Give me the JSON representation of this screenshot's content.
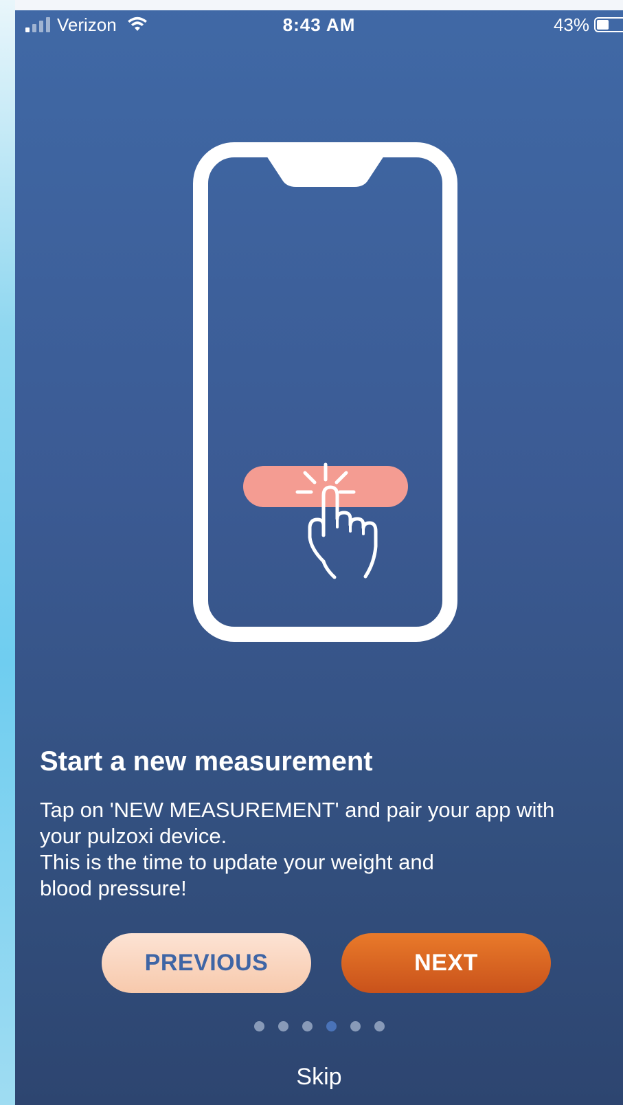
{
  "status_bar": {
    "carrier": "Verizon",
    "time": "8:43 AM",
    "battery_percent": "43%",
    "battery_level": 0.43
  },
  "illustration": {
    "icon": "phone-tap-icon",
    "button_color": "#f49c92"
  },
  "onboarding": {
    "title": "Start a new measurement",
    "description_lines": [
      "Tap on 'NEW MEASUREMENT' and pair your app with",
      "your pulzoxi device.",
      "This is the time to update your weight and",
      "blood pressure!"
    ]
  },
  "buttons": {
    "previous_label": "PREVIOUS",
    "next_label": "NEXT",
    "skip_label": "Skip"
  },
  "pagination": {
    "total": 6,
    "current": 4
  },
  "colors": {
    "accent": "#dc6a24",
    "background_top": "#4069a6",
    "background_bottom": "#2d4570"
  }
}
